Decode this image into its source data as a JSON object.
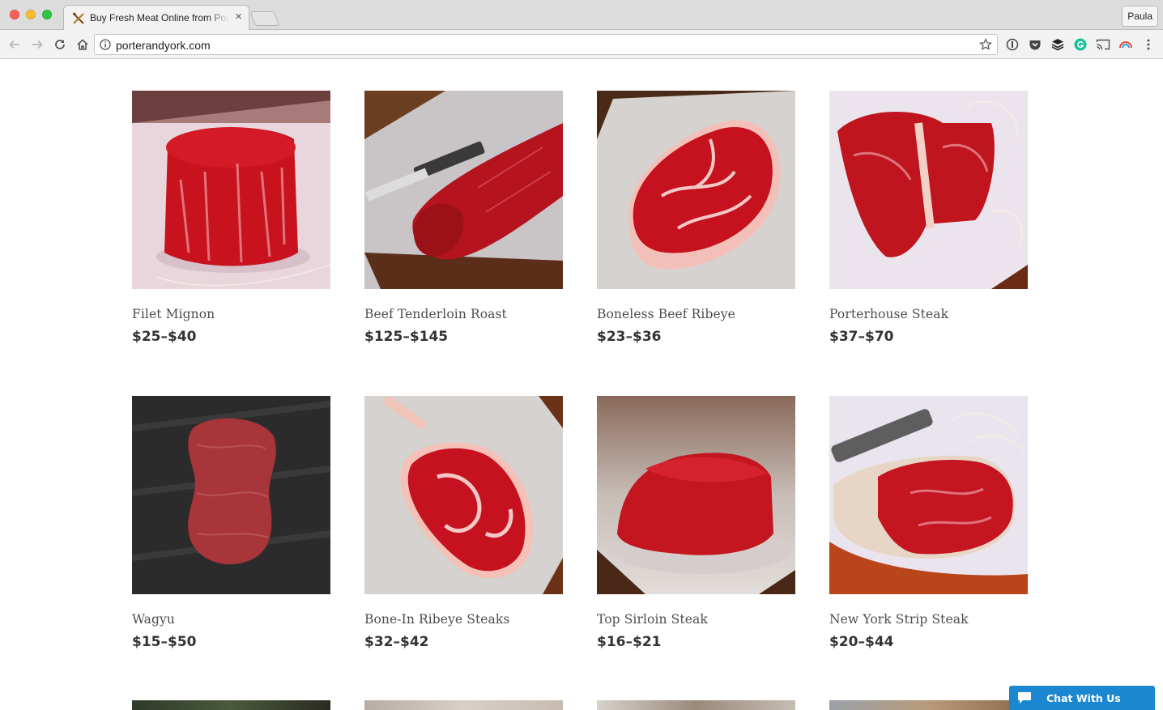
{
  "browser": {
    "tab_title": "Buy Fresh Meat Online from Porter and York",
    "tab_close": "×",
    "profile_name": "Paula",
    "url": "porterandyork.com"
  },
  "products": [
    {
      "name": "Filet Mignon",
      "price": "$25–$40"
    },
    {
      "name": "Beef Tenderloin Roast",
      "price": "$125–$145"
    },
    {
      "name": "Boneless Beef Ribeye",
      "price": "$23–$36"
    },
    {
      "name": "Porterhouse Steak",
      "price": "$37–$70"
    },
    {
      "name": "Wagyu",
      "price": "$15–$50"
    },
    {
      "name": "Bone-In Ribeye Steaks",
      "price": "$32–$42"
    },
    {
      "name": "Top Sirloin Steak",
      "price": "$16–$21"
    },
    {
      "name": "New York Strip Steak",
      "price": "$20–$44"
    }
  ],
  "chat": {
    "label": "Chat With Us"
  },
  "colors": {
    "chat_accent": "#1a87d0",
    "price_text": "#333333",
    "name_text": "#4d4d4d"
  }
}
